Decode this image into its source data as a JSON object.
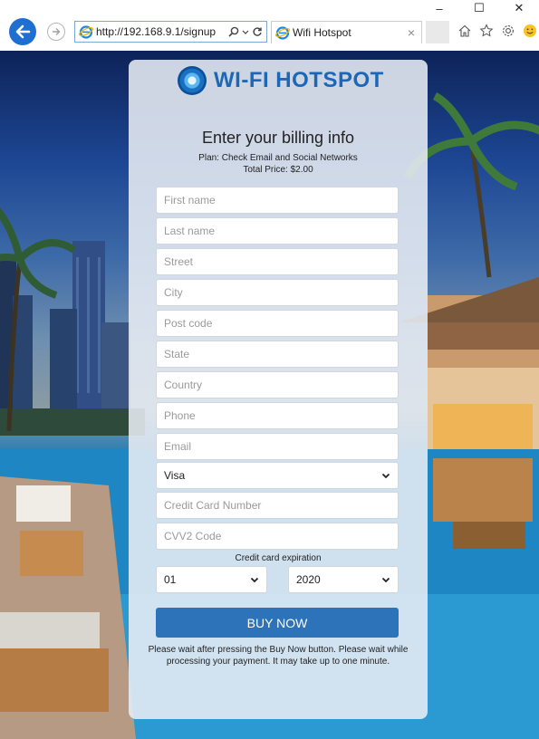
{
  "browser": {
    "window_controls": [
      "–",
      "☐",
      "✕"
    ],
    "url": "http://192.168.9.1/signup",
    "tab_title": "Wifi Hotspot",
    "tab_close": "×"
  },
  "logo": {
    "text": "WI-FI HOTSPOT"
  },
  "form": {
    "heading": "Enter your billing info",
    "plan_line": "Plan: Check Email and Social Networks",
    "price_line": "Total Price: $2.00",
    "fields": {
      "first_name": "First name",
      "last_name": "Last name",
      "street": "Street",
      "city": "City",
      "post_code": "Post code",
      "state": "State",
      "country": "Country",
      "phone": "Phone",
      "email": "Email",
      "card_number": "Credit Card Number",
      "cvv2": "CVV2 Code"
    },
    "card_type": "Visa",
    "expiration_label": "Credit card expiration",
    "exp_month": "01",
    "exp_year": "2020",
    "buy_label": "BUY NOW",
    "notice": "Please wait after pressing the Buy Now button. Please wait while processing your payment. It may take up to one minute."
  },
  "colors": {
    "accent": "#2d73b9",
    "logo": "#1d67b7",
    "back_button": "#1f6fd1"
  }
}
